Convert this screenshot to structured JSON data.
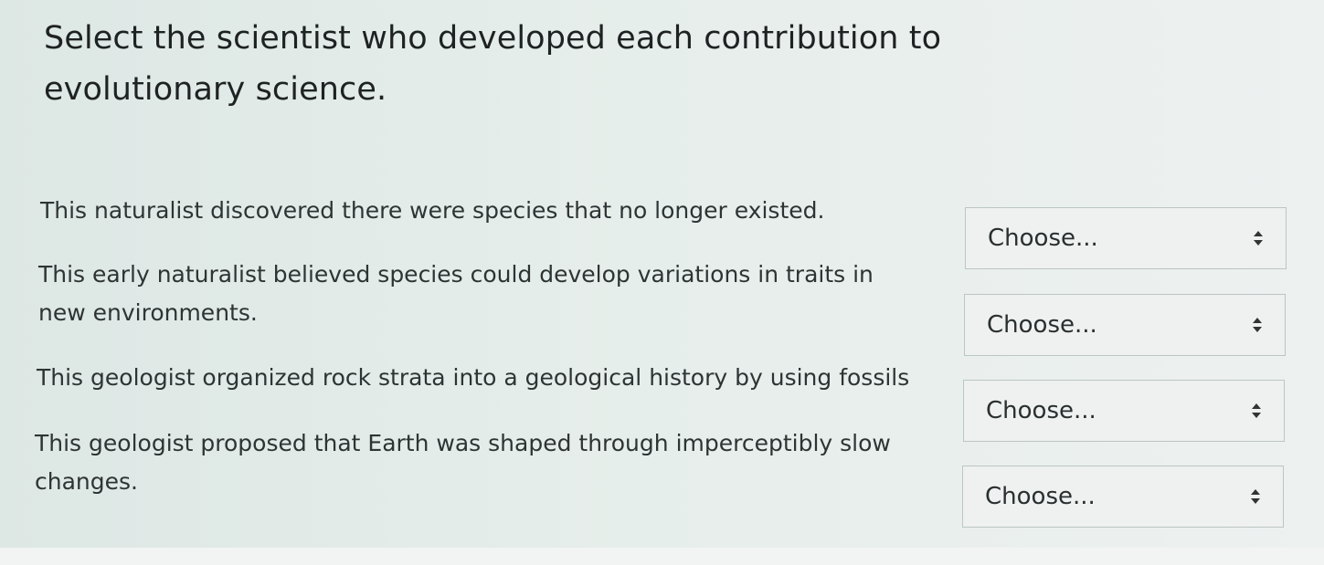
{
  "question": {
    "title": "Select the scientist who developed each contribution to evolutionary science."
  },
  "items": [
    {
      "text": "This naturalist discovered there were species that no longer existed.",
      "select_value": "Choose..."
    },
    {
      "text": "This early naturalist believed species could develop variations in traits in new environments.",
      "select_value": "Choose..."
    },
    {
      "text": "This geologist organized rock strata into a geological history by using fossils",
      "select_value": "Choose..."
    },
    {
      "text": "This geologist proposed that Earth was shaped through imperceptibly slow changes.",
      "select_value": "Choose..."
    }
  ],
  "icons": {
    "select_arrow": "sort-updown-icon"
  },
  "colors": {
    "background": "#e6eeec",
    "select_background": "#eef1f0",
    "select_border": "#bcc6c3",
    "text": "#2e3434"
  }
}
